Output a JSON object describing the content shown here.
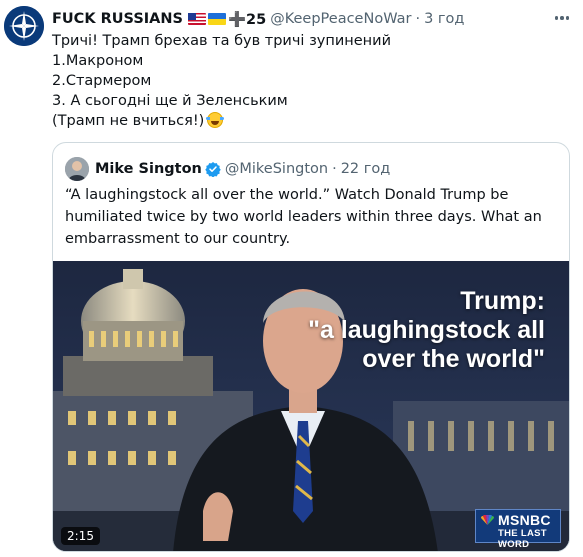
{
  "tweet": {
    "author_name": "FUCK RUSSIANS",
    "author_suffix": "➕25",
    "handle": "@KeepPeaceNoWar",
    "separator": "·",
    "time": "3 год",
    "lines": [
      "Тричі! Трамп брехав та був тричі зупинений",
      "1.Макроном",
      "2.Стармером",
      "3. А сьогодні ще й Зеленським",
      "(Трамп не вчиться!)"
    ],
    "icons": {
      "avatar": "nato-compass-icon",
      "flag1": "us-flag-icon",
      "flag2": "ukraine-flag-icon",
      "emoji": "tears-of-joy-emoji-icon",
      "more": "more-icon"
    }
  },
  "quote": {
    "author_name": "Mike Sington",
    "handle": "@MikeSington",
    "separator": "·",
    "time": "22 год",
    "text": "“A laughingstock all over the world.” Watch Donald Trump be humiliated twice by two world leaders within three days. What an embarrassment to our country.",
    "video": {
      "overlay_line1": "Trump:",
      "overlay_line2": "\"a laughingstock all",
      "overlay_line3": "over the world\"",
      "duration": "2:15",
      "network": "MSNBC",
      "program": "THE LAST WORD"
    }
  },
  "colors": {
    "text": "#0f1419",
    "secondary": "#536471",
    "border": "#cfd9de",
    "verified": "#1d9bf0"
  }
}
